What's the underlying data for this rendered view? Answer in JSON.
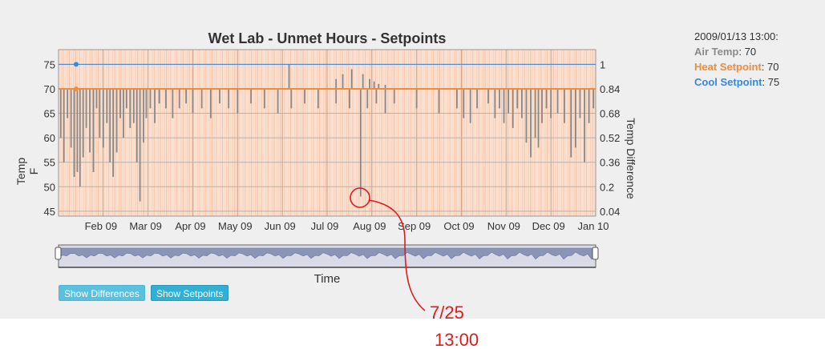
{
  "chart_data": {
    "type": "bar",
    "title": "Wet Lab - Unmet Hours - Setpoints",
    "ylabel": "Temp F",
    "ylabel_right": "Temp Difference",
    "xlabel": "Time",
    "ylim": [
      44,
      78
    ],
    "yticks": [
      45,
      50,
      55,
      60,
      65,
      70,
      75
    ],
    "ylim_right": [
      0,
      1.1
    ],
    "yticks_right": [
      "0.04",
      "0.2",
      "0.36",
      "0.52",
      "0.68",
      "0.84",
      "1"
    ],
    "x_tick_labels": [
      "Feb 09",
      "Mar 09",
      "Apr 09",
      "May 09",
      "Jun 09",
      "Jul 09",
      "Aug 09",
      "Sep 09",
      "Oct 09",
      "Nov 09",
      "Dec 09",
      "Jan 10"
    ],
    "x_tick_months": [
      1,
      2,
      3,
      4,
      5,
      6,
      7,
      8,
      9,
      10,
      11,
      12
    ],
    "x_range_months": [
      0.0,
      12.0
    ],
    "heat_setpoint": 70,
    "cool_setpoint": 75,
    "series": [
      {
        "name": "Air Temp",
        "color": "#888888",
        "x": [
          0.05,
          0.12,
          0.2,
          0.28,
          0.35,
          0.42,
          0.48,
          0.55,
          0.62,
          0.7,
          0.78,
          0.85,
          0.92,
          1.0,
          1.08,
          1.15,
          1.22,
          1.3,
          1.38,
          1.45,
          1.52,
          1.6,
          1.68,
          1.75,
          1.82,
          1.9,
          1.96,
          2.05,
          2.15,
          2.25,
          2.4,
          2.55,
          2.7,
          2.85,
          3.0,
          3.2,
          3.4,
          3.6,
          3.8,
          4.0,
          4.3,
          4.6,
          4.9,
          5.2,
          5.5,
          5.8,
          6.2,
          6.5,
          6.75,
          6.9,
          7.1,
          7.3,
          7.5,
          8.0,
          8.5,
          8.9,
          9.05,
          9.2,
          9.35,
          9.6,
          9.75,
          9.85,
          9.95,
          10.05,
          10.15,
          10.25,
          10.35,
          10.45,
          10.55,
          10.65,
          10.72,
          10.8,
          10.9,
          11.0,
          11.15,
          11.3,
          11.45,
          11.55,
          11.65,
          11.75,
          11.85,
          11.95
        ],
        "values": [
          60,
          55,
          64,
          58,
          52,
          53,
          50,
          56,
          62,
          57,
          53,
          66,
          60,
          58,
          63,
          55,
          52,
          57,
          64,
          60,
          66,
          62,
          63,
          55,
          47,
          59,
          64,
          66,
          63,
          67,
          66,
          64,
          66,
          67,
          65,
          66,
          64,
          67,
          66,
          65,
          67,
          66,
          65,
          66,
          67,
          66,
          67,
          66,
          48,
          66,
          67,
          65,
          67,
          66,
          65,
          66,
          64,
          63,
          66,
          67,
          64,
          66,
          63,
          65,
          62,
          66,
          64,
          59,
          56,
          60,
          58,
          63,
          66,
          64,
          65,
          63,
          56,
          58,
          64,
          55,
          63,
          66
        ]
      },
      {
        "name": "Air Temp",
        "color": "#888888",
        "x": [
          5.15,
          6.2,
          6.35,
          6.55,
          6.8,
          6.95,
          7.05,
          7.15,
          7.3
        ],
        "values": [
          75,
          72,
          73,
          74,
          73,
          72,
          71.5,
          71,
          70.8
        ]
      }
    ]
  },
  "readout": {
    "timestamp": "2009/01/13 13:00:",
    "air_temp_label": "Air Temp",
    "air_temp_value": ": 70",
    "heat_label": "Heat Setpoint",
    "heat_value": ": 70",
    "cool_label": "Cool Setpoint",
    "cool_value": ": 75"
  },
  "buttons": {
    "show_differences": "Show Differences",
    "show_setpoints": "Show Setpoints"
  },
  "annotation": {
    "line1": "7/25",
    "line2": "13:00"
  },
  "colors": {
    "heat": "#f08c3b",
    "cool": "#3a86d8",
    "air": "#888888",
    "button": "#5bc0de"
  }
}
